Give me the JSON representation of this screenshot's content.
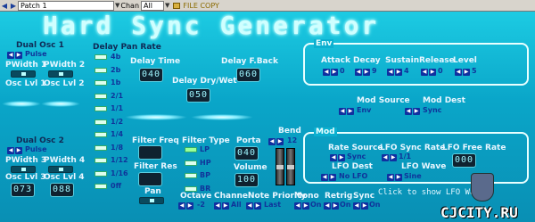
{
  "toolbar": {
    "patch_value": "Patch  1",
    "chan_label": "Chan",
    "chan_value": "All",
    "file_copy": "FILE COPY"
  },
  "title": "Hard Sync Generator",
  "osc1": {
    "title": "Dual Osc 1",
    "waveform": "Pulse",
    "pwidth1": "PWidth 1",
    "pwidth2": "PWidth 2",
    "osc_lvl1": "Osc Lvl 1",
    "osc_lvl2": "Osc Lvl 2"
  },
  "osc2": {
    "title": "Dual Osc 2",
    "waveform": "Pulse",
    "pwidth3": "PWidth 3",
    "pwidth4": "PWidth 4",
    "osc_lvl3": "Osc Lvl 3",
    "osc_lvl4": "Osc Lvl 4",
    "lvl3_value": "073",
    "lvl4_value": "088"
  },
  "delay": {
    "pan_rate": "Delay Pan Rate",
    "rates": [
      "4b",
      "2b",
      "1b",
      "2/1",
      "1/1",
      "1/2",
      "1/4",
      "1/8",
      "1/12",
      "1/16",
      "0ff"
    ],
    "time_label": "Delay Time",
    "time_value": "040",
    "fback_label": "Delay F.Back",
    "fback_value": "060",
    "drywet_label": "Delay Dry/Wet",
    "drywet_value": "050"
  },
  "filter": {
    "freq_label": "Filter Freq",
    "res_label": "Filter Res",
    "type_label": "Filter Type",
    "types": [
      "LP",
      "HP",
      "BP",
      "BR"
    ],
    "pan_label": "Pan"
  },
  "porta": {
    "label": "Porta",
    "value": "040"
  },
  "volume": {
    "label": "Volume",
    "value": "100"
  },
  "bend": {
    "label": "Bend",
    "value": "12"
  },
  "env": {
    "title": "Env",
    "params": [
      {
        "label": "Attack",
        "value": "0"
      },
      {
        "label": "Decay",
        "value": "9"
      },
      {
        "label": "Sustain",
        "value": "4"
      },
      {
        "label": "Release",
        "value": "0"
      },
      {
        "label": "Level",
        "value": "5"
      }
    ],
    "mod_source_label": "Mod Source",
    "mod_source_value": "Env",
    "mod_dest_label": "Mod Dest",
    "mod_dest_value": "Sync"
  },
  "mod": {
    "title": "Mod",
    "rate_source_label": "Rate Source",
    "rate_source_value": "Sync",
    "lfo_sync_label": "LFO Sync Rate",
    "lfo_sync_value": "1/1",
    "lfo_free_label": "LFO Free Rate",
    "lfo_free_value": "000",
    "lfo_dest_label": "LFO Dest",
    "lfo_dest_value": "No LFO",
    "lfo_wave_label": "LFO Wave",
    "lfo_wave_value": "Sine"
  },
  "bottom": {
    "octave_label": "Octave",
    "octave_value": "-2",
    "channel_label": "Channel",
    "channel_value": "All",
    "note_priority_label": "Note Priority",
    "note_priority_value": "Last",
    "mono_label": "Mono",
    "mono_value": "On",
    "retrig_label": "Retrig",
    "retrig_value": "On",
    "sync_label": "Sync",
    "sync_value": "On"
  },
  "hint": "Click to show LFO Wave",
  "watermark": "CJCITY.RU"
}
